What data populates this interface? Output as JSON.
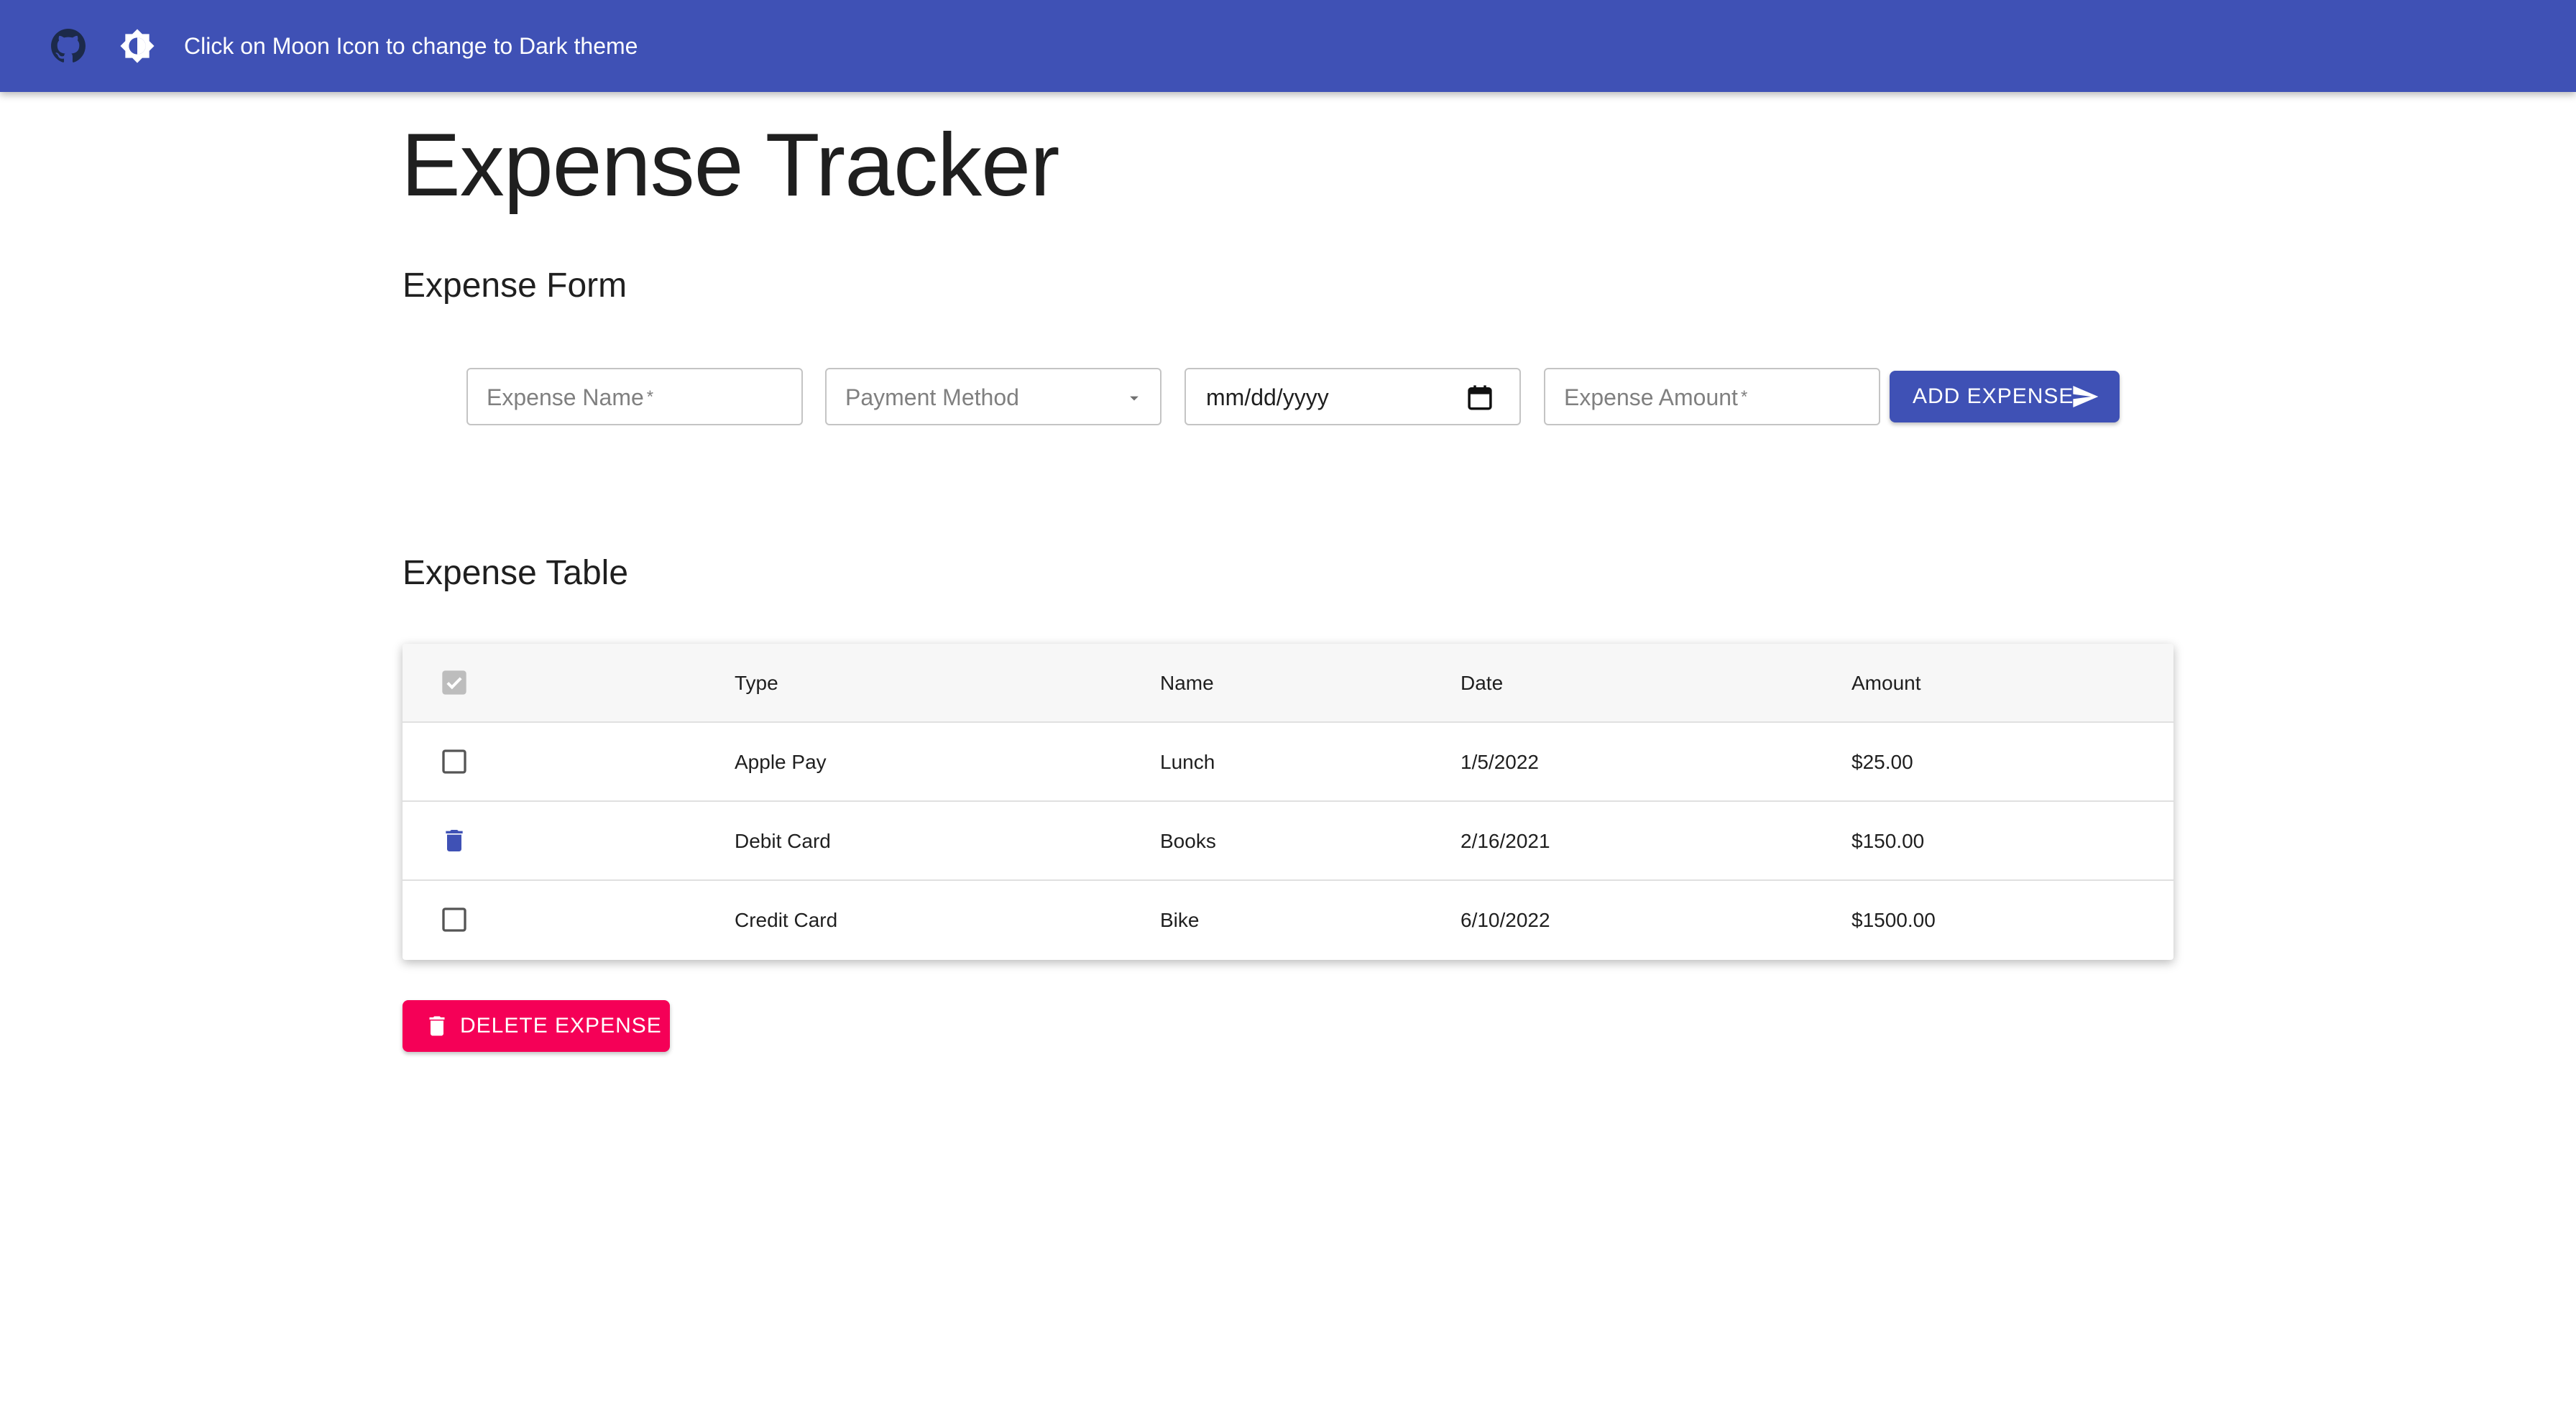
{
  "appbar": {
    "hint": "Click on Moon Icon to change to Dark theme",
    "background": "#3f51b5",
    "icons": [
      "github-icon",
      "brightness-icon"
    ]
  },
  "page": {
    "title": "Expense Tracker"
  },
  "form": {
    "title": "Expense Form",
    "name_placeholder": "Expense Name",
    "method_placeholder": "Payment Method",
    "date_value": "mm/dd/yyyy",
    "amount_placeholder": "Expense Amount",
    "required_mark": "*",
    "add_label": "ADD EXPENSE"
  },
  "table": {
    "title": "Expense Table",
    "columns": [
      "Type",
      "Name",
      "Date",
      "Amount"
    ],
    "rows": [
      {
        "type": "Apple Pay",
        "name": "Lunch",
        "date": "1/5/2022",
        "amount": "$25.00",
        "control": "checkbox"
      },
      {
        "type": "Debit Card",
        "name": "Books",
        "date": "2/16/2021",
        "amount": "$150.00",
        "control": "delete-icon"
      },
      {
        "type": "Credit Card",
        "name": "Bike",
        "date": "6/10/2022",
        "amount": "$1500.00",
        "control": "checkbox"
      }
    ]
  },
  "actions": {
    "delete_label": "DELETE EXPENSE",
    "delete_color": "#f50057",
    "primary_color": "#3f51b5"
  }
}
